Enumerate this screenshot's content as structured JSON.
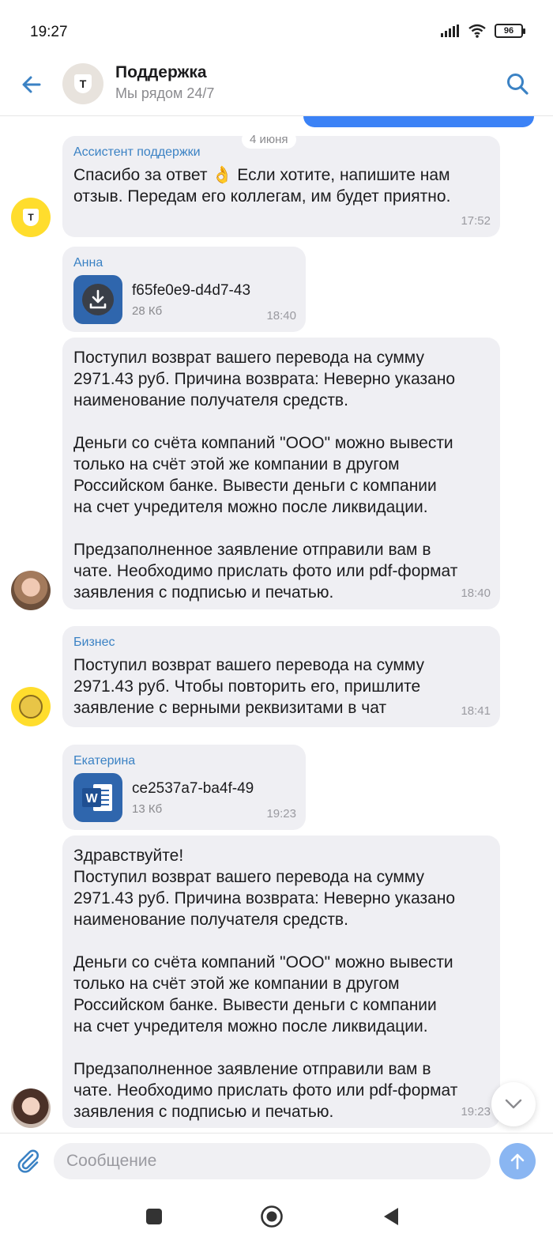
{
  "status_bar": {
    "time": "19:27",
    "battery": "96"
  },
  "header": {
    "title": "Поддержка",
    "subtitle": "Мы рядом 24/7",
    "avatar_letter": "T"
  },
  "chat": {
    "date_chip": "4 июня",
    "messages": [
      {
        "sender": "Ассистент поддержки",
        "text": "Спасибо за ответ 👌 Если хотите, напишите нам\nотзыв. Передам его коллегам, им будет приятно.",
        "time": "17:52"
      },
      {
        "sender": "Анна",
        "file_name": "f65fe0e9-d4d7-43",
        "file_size": "28 Кб",
        "time": "18:40"
      },
      {
        "text": "Поступил возврат вашего перевода на сумму\n2971.43 руб. Причина возврата: Неверно указано\nнаименование получателя средств.\n\nДеньги со счёта компаний \"ООО\" можно вывести\nтолько на счёт этой же компании в другом\nРоссийском банке. Вывести деньги с компании\nна счет учредителя можно после ликвидации.\n\nПредзаполненное заявление отправили вам в\nчате. Необходимо прислать фото или pdf-формат\nзаявления с подписью и печатью.",
        "time": "18:40"
      },
      {
        "sender": "Бизнес",
        "text": "Поступил возврат вашего перевода на сумму\n2971.43 руб. Чтобы повторить его, пришлите\nзаявление с верными реквизитами в чат",
        "time": "18:41"
      },
      {
        "sender": "Екатерина",
        "file_name": "ce2537a7-ba4f-49",
        "file_size": "13 Кб",
        "file_badge": "W",
        "time": "19:23"
      },
      {
        "text": "Здравствуйте!\nПоступил возврат вашего перевода на сумму\n2971.43 руб. Причина возврата: Неверно указано\nнаименование получателя средств.\n\nДеньги со счёта компаний \"ООО\" можно вывести\nтолько на счёт этой же компании в другом\nРоссийском банке. Вывести деньги с компании\nна счет учредителя можно после ликвидации.\n\nПредзаполненное заявление отправили вам в\nчате. Необходимо прислать фото или pdf-формат\nзаявления с подписью и печатью.",
        "time": "19:23"
      }
    ]
  },
  "composer": {
    "placeholder": "Сообщение"
  },
  "colors": {
    "accent": "#3b82f6",
    "bubble": "#efeff3",
    "sender": "#3b82c4",
    "brand_yellow": "#ffdd2d"
  }
}
